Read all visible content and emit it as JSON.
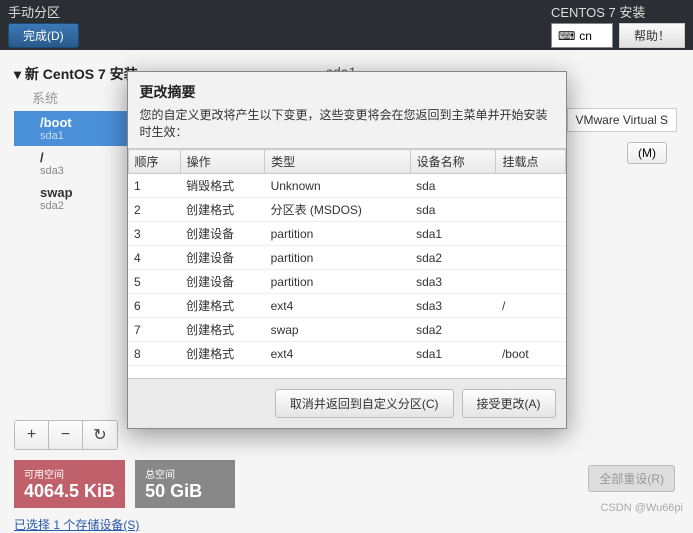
{
  "topbar": {
    "title": "手动分区",
    "done": "完成(D)",
    "install_title": "CENTOS 7 安装",
    "lang": "cn",
    "help": "帮助！"
  },
  "tree": {
    "header": "新 CentOS 7 安装",
    "system": "系统",
    "items": [
      {
        "mount": "/boot",
        "dev": "sda1"
      },
      {
        "mount": "/",
        "dev": "sda3"
      },
      {
        "mount": "swap",
        "dev": "sda2"
      }
    ]
  },
  "right": {
    "title": "sda1",
    "device": "VMware Virtual S",
    "modify_btn": "(M)"
  },
  "toolbar": {
    "plus": "+",
    "minus": "−",
    "reload": "↻"
  },
  "space": {
    "avail_label": "可用空间",
    "avail": "4064.5 KiB",
    "total_label": "总空间",
    "total": "50 GiB"
  },
  "link": "已选择 1 个存储设备(S)",
  "reset_btn": "全部重设(R)",
  "watermark": "CSDN @Wu66pi",
  "dialog": {
    "title": "更改摘要",
    "desc": "您的自定义更改将产生以下变更，这些变更将会在您返回到主菜单并开始安装时生效：",
    "cols": {
      "order": "顺序",
      "op": "操作",
      "type": "类型",
      "devname": "设备名称",
      "mount": "挂载点"
    },
    "rows": [
      {
        "order": "1",
        "op": "销毁格式",
        "op_class": "op-destroy",
        "type": "Unknown",
        "dev": "sda",
        "mount": ""
      },
      {
        "order": "2",
        "op": "创建格式",
        "op_class": "op-create",
        "type": "分区表 (MSDOS)",
        "dev": "sda",
        "mount": ""
      },
      {
        "order": "3",
        "op": "创建设备",
        "op_class": "op-create",
        "type": "partition",
        "dev": "sda1",
        "mount": ""
      },
      {
        "order": "4",
        "op": "创建设备",
        "op_class": "op-create",
        "type": "partition",
        "dev": "sda2",
        "mount": ""
      },
      {
        "order": "5",
        "op": "创建设备",
        "op_class": "op-create",
        "type": "partition",
        "dev": "sda3",
        "mount": ""
      },
      {
        "order": "6",
        "op": "创建格式",
        "op_class": "op-create",
        "type": "ext4",
        "dev": "sda3",
        "mount": "/"
      },
      {
        "order": "7",
        "op": "创建格式",
        "op_class": "op-create",
        "type": "swap",
        "dev": "sda2",
        "mount": ""
      },
      {
        "order": "8",
        "op": "创建格式",
        "op_class": "op-create",
        "type": "ext4",
        "dev": "sda1",
        "mount": "/boot"
      }
    ],
    "cancel": "取消并返回到自定义分区(C)",
    "accept": "接受更改(A)"
  }
}
